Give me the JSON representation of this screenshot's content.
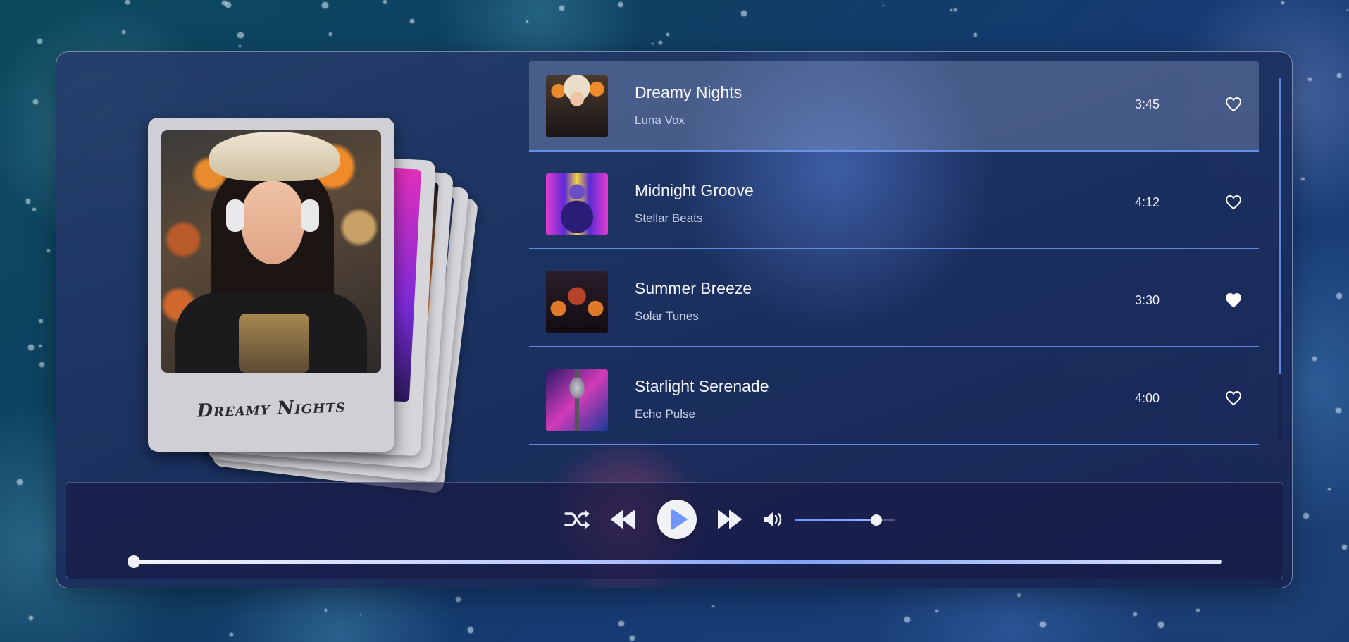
{
  "now_playing": {
    "caption": "Dreamy Nights"
  },
  "tracks": [
    {
      "title": "Dreamy Nights",
      "artist": "Luna Vox",
      "duration": "3:45",
      "liked": false,
      "active": true
    },
    {
      "title": "Midnight Groove",
      "artist": "Stellar Beats",
      "duration": "4:12",
      "liked": false,
      "active": false
    },
    {
      "title": "Summer Breeze",
      "artist": "Solar Tunes",
      "duration": "3:30",
      "liked": true,
      "active": false
    },
    {
      "title": "Starlight Serenade",
      "artist": "Echo Pulse",
      "duration": "4:00",
      "liked": false,
      "active": false
    }
  ],
  "controls": {
    "icons": [
      "shuffle-icon",
      "rewind-icon",
      "play-icon",
      "fast-forward-icon",
      "volume-icon"
    ],
    "volume_level": 0.82,
    "progress": 0.0
  },
  "colors": {
    "accent": "#6f96ff",
    "divider": "#6e96f5",
    "play_icon": "#6f96ff"
  }
}
